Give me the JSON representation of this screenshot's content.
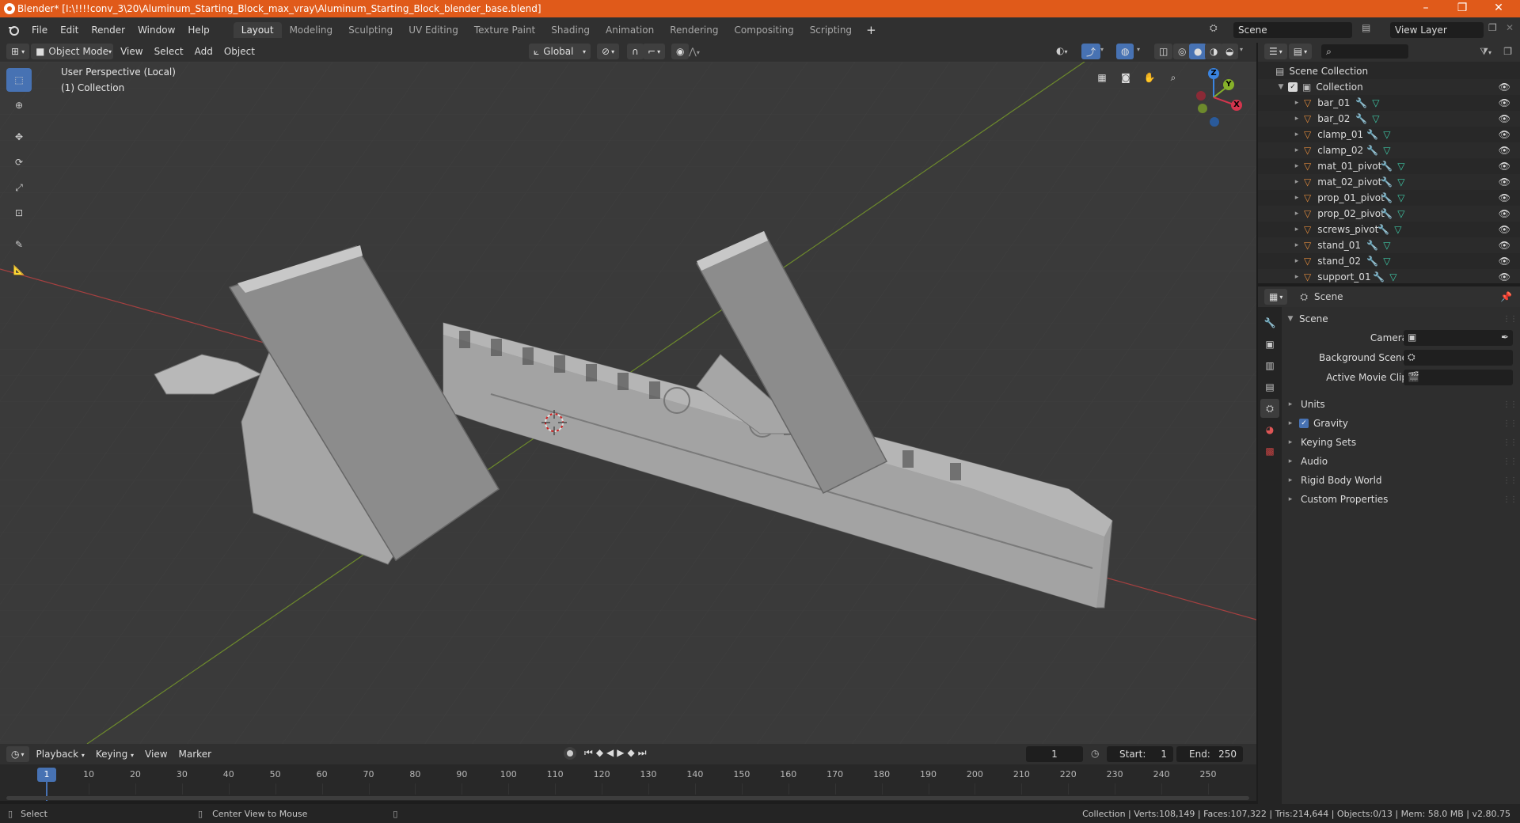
{
  "window": {
    "title": "Blender* [I:\\!!!!conv_3\\20\\Aluminum_Starting_Block_max_vray\\Aluminum_Starting_Block_blender_base.blend]",
    "minimize": "–",
    "maximize": "❐",
    "close": "✕"
  },
  "menu": [
    "File",
    "Edit",
    "Render",
    "Window",
    "Help"
  ],
  "workspaces": [
    "Layout",
    "Modeling",
    "Sculpting",
    "UV Editing",
    "Texture Paint",
    "Shading",
    "Animation",
    "Rendering",
    "Compositing",
    "Scripting"
  ],
  "workspace_add": "+",
  "scene_field": "Scene",
  "view_layer_field": "View Layer",
  "viewport": {
    "mode": "Object Mode",
    "menus": [
      "View",
      "Select",
      "Add",
      "Object"
    ],
    "transform_orientation": "Global",
    "perspective_label": "User Perspective (Local)",
    "collection_label": "(1) Collection",
    "gizmo": {
      "x": "X",
      "y": "Y",
      "z": "Z"
    }
  },
  "timeline": {
    "menus": [
      "Playback",
      "Keying",
      "View",
      "Marker"
    ],
    "current_frame": "1",
    "start_label": "Start:",
    "start": "1",
    "end_label": "End:",
    "end": "250",
    "ticks": [
      "1",
      "10",
      "20",
      "30",
      "40",
      "50",
      "60",
      "70",
      "80",
      "90",
      "100",
      "110",
      "120",
      "130",
      "140",
      "150",
      "160",
      "170",
      "180",
      "190",
      "200",
      "210",
      "220",
      "230",
      "240",
      "250"
    ]
  },
  "statusbar": {
    "left_action": "Select",
    "mid_action": "Center View to Mouse",
    "stats": "Collection | Verts:108,149 | Faces:107,322 | Tris:214,644 | Objects:0/13 | Mem: 58.0 MB | v2.80.75"
  },
  "outliner": {
    "root": "Scene Collection",
    "collection": "Collection",
    "objects": [
      "bar_01",
      "bar_02",
      "clamp_01",
      "clamp_02",
      "mat_01_pivot",
      "mat_02_pivot",
      "prop_01_pivot",
      "prop_02_pivot",
      "screws_pivot",
      "stand_01",
      "stand_02",
      "support_01"
    ]
  },
  "properties": {
    "context": "Scene",
    "panel_title": "Scene",
    "fields": [
      {
        "label": "Camera"
      },
      {
        "label": "Background Scene"
      },
      {
        "label": "Active Movie Clip"
      }
    ],
    "sections": [
      "Units",
      "Gravity",
      "Keying Sets",
      "Audio",
      "Rigid Body World",
      "Custom Properties"
    ],
    "gravity_checked": true
  },
  "colors": {
    "titlebar": "#e05a1a",
    "active_tool": "#4772b3",
    "mesh_icon": "#e08a3c",
    "modifier_icon": "#6aa0e0",
    "data_icon": "#3ec9a7",
    "axis_x": "#d3354d",
    "axis_y": "#86b12a",
    "axis_z": "#3a84e0"
  }
}
